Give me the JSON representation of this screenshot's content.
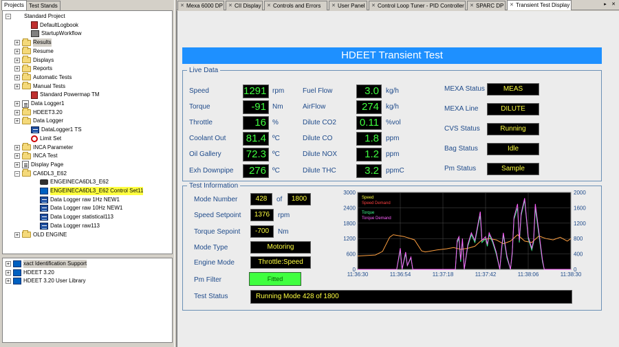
{
  "left_panel": {
    "tabs": [
      "Projects",
      "Test Stands"
    ],
    "tree": [
      {
        "label": "Standard Project",
        "icon": "project",
        "exp": "−",
        "level": 0
      },
      {
        "label": "DefaultLogbook",
        "icon": "book",
        "level": 2
      },
      {
        "label": "StartupWorkflow",
        "icon": "wf",
        "level": 2
      },
      {
        "label": "Results",
        "icon": "folder",
        "exp": "+",
        "level": 1
      },
      {
        "label": "Resume",
        "icon": "folder",
        "exp": "+",
        "level": 1
      },
      {
        "label": "Displays",
        "icon": "folder",
        "exp": "+",
        "level": 1
      },
      {
        "label": "Reports",
        "icon": "folder",
        "exp": "+",
        "level": 1
      },
      {
        "label": "Automatic Tests",
        "icon": "folder",
        "exp": "+",
        "level": 1
      },
      {
        "label": "Manual Tests",
        "icon": "folder",
        "exp": "+",
        "level": 1
      },
      {
        "label": "Standard Powermap TM",
        "icon": "book",
        "level": 2
      },
      {
        "label": "Data Logger1",
        "icon": "doc",
        "exp": "+",
        "level": 1
      },
      {
        "label": "HDEET3.20",
        "icon": "folder",
        "exp": "+",
        "level": 1
      },
      {
        "label": "Data Logger",
        "icon": "folder",
        "exp": "+",
        "level": 1
      },
      {
        "label": "DataLogger1 TS",
        "icon": "dl",
        "level": 2
      },
      {
        "label": "Limit Set",
        "icon": "limit",
        "level": 2
      },
      {
        "label": "INCA Parameter",
        "icon": "folder",
        "exp": "+",
        "level": 1
      },
      {
        "label": "INCA Test",
        "icon": "folder",
        "exp": "+",
        "level": 1
      },
      {
        "label": "Display Page",
        "icon": "doc",
        "exp": "+",
        "level": 1
      },
      {
        "label": "CA6DL3_E62",
        "icon": "folder",
        "exp": "−",
        "level": 1
      },
      {
        "label": "ENGEINECA6DL3_E62",
        "icon": "eng",
        "level": 3
      },
      {
        "label": "ENGEINECA6DL3_E62 Control Set11",
        "icon": "ctrl",
        "level": 3,
        "selected": true
      },
      {
        "label": "Data Logger raw  1Hz NEW1",
        "icon": "dl",
        "level": 3
      },
      {
        "label": "Data Logger raw 10Hz NEW1",
        "icon": "dl",
        "level": 3
      },
      {
        "label": "Data Logger statistical113",
        "icon": "dl",
        "level": 3
      },
      {
        "label": "Data Logger raw113",
        "icon": "dl",
        "level": 3
      },
      {
        "label": "OLD ENGINE",
        "icon": "folder",
        "exp": "+",
        "level": 1
      }
    ],
    "tree2": [
      {
        "label": "xact Identification Support",
        "icon": "ctrl",
        "exp": "+",
        "selected_gray": true
      },
      {
        "label": "HDEET 3.20",
        "icon": "ctrl",
        "exp": "+"
      },
      {
        "label": "HDEET 3.20 User Library",
        "icon": "ctrl",
        "exp": "+"
      }
    ]
  },
  "tabs": [
    {
      "label": "Mexa 6000 DP"
    },
    {
      "label": "CII Display"
    },
    {
      "label": "Controls and Errors"
    },
    {
      "label": "User Panel"
    },
    {
      "label": "Control Loop Tuner - PID Controller"
    },
    {
      "label": "SPARC DP"
    },
    {
      "label": "Transient Test Display",
      "active": true
    }
  ],
  "main": {
    "title": "HDEET Transient Test",
    "live_data": {
      "title": "Live Data",
      "col1": [
        {
          "label": "Speed",
          "value": "1291",
          "unit": "rpm"
        },
        {
          "label": "Torque",
          "value": "-91",
          "unit": "Nm"
        },
        {
          "label": "Throttle",
          "value": "16",
          "unit": "%"
        },
        {
          "label": "Coolant Out",
          "value": "81.4",
          "unit": "ºC"
        },
        {
          "label": "Oil Gallery",
          "value": "72.3",
          "unit": "ºC"
        },
        {
          "label": "Exh Downpipe",
          "value": "276",
          "unit": "ºC"
        }
      ],
      "col2": [
        {
          "label": "Fuel Flow",
          "value": "3.0",
          "unit": "kg/h"
        },
        {
          "label": "AirFlow",
          "value": "274",
          "unit": "kg/h"
        },
        {
          "label": "Dilute CO2",
          "value": "0.11",
          "unit": "%vol"
        },
        {
          "label": "Dilute CO",
          "value": "1.8",
          "unit": "ppm"
        },
        {
          "label": "Dilute NOX",
          "value": "1.2",
          "unit": "ppm"
        },
        {
          "label": "Dilute THC",
          "value": "3.2",
          "unit": "ppmC"
        }
      ],
      "col3": [
        {
          "label": "MEXA Status",
          "value": "MEAS"
        },
        {
          "label": "MEXA Line",
          "value": "DILUTE"
        },
        {
          "label": "CVS Status",
          "value": "Running"
        },
        {
          "label": "Bag Status",
          "value": "Idle"
        },
        {
          "label": "Pm Status",
          "value": "Sample"
        }
      ]
    },
    "test_info": {
      "title": "Test Information",
      "mode_number_label": "Mode Number",
      "mode_number": "428",
      "of_label": "of",
      "mode_total": "1800",
      "speed_setpoint_label": "Speed Setpoint",
      "speed_setpoint": "1376",
      "speed_unit": "rpm",
      "torque_setpoint_label": "Torque Sepoint",
      "torque_setpoint": "-700",
      "torque_unit": "Nm",
      "mode_type_label": "Mode Type",
      "mode_type": "Motoring",
      "engine_mode_label": "Engine Mode",
      "engine_mode": "Throttle:Speed",
      "pm_filter_label": "Pm Filter",
      "pm_filter": "Fitted",
      "test_status_label": "Test Status",
      "test_status": "Running Mode 428 of 1800"
    }
  },
  "chart_data": {
    "type": "line",
    "x_ticks": [
      "11:36:30",
      "11:36:54",
      "11:37:18",
      "11:37:42",
      "11:38:06",
      "11:38:30"
    ],
    "y_left_ticks": [
      "3000",
      "2400",
      "1800",
      "1200",
      "600",
      "0"
    ],
    "y_right_ticks": [
      "2000",
      "1600",
      "1200",
      "800",
      "400",
      "0"
    ],
    "ylim_left": [
      0,
      3000
    ],
    "ylim_right": [
      0,
      2000
    ],
    "xlim": [
      0,
      120
    ],
    "legend": [
      "Speed",
      "Speed Demand",
      "Torque",
      "Torque Demand"
    ],
    "colors": {
      "Speed": "#ffff40",
      "Speed Demand": "#ff4040",
      "Torque": "#40ff90",
      "Torque Demand": "#ff60ff",
      "speed_line": "#ffa040"
    },
    "series": [
      {
        "name": "Speed",
        "axis": "left",
        "color": "#ffa040",
        "x": [
          0,
          10,
          14,
          18,
          20,
          26,
          32,
          36,
          38,
          40,
          45,
          50,
          54,
          58,
          62,
          66,
          70,
          74,
          78,
          82,
          86,
          90,
          94,
          98,
          102,
          106,
          110,
          114,
          118,
          120
        ],
        "y": [
          520,
          560,
          700,
          1250,
          1350,
          1280,
          1150,
          720,
          680,
          700,
          760,
          800,
          850,
          780,
          820,
          900,
          1150,
          1200,
          1150,
          1000,
          1100,
          1350,
          1100,
          1050,
          1300,
          1200,
          1150,
          1250,
          1100,
          1200
        ]
      },
      {
        "name": "Torque",
        "axis": "right",
        "color": "#40ff90",
        "x": [
          0,
          22,
          24,
          25,
          27,
          28,
          30,
          31,
          50,
          55,
          56,
          57,
          58,
          59,
          60,
          62,
          64,
          66,
          68,
          69,
          70,
          72,
          73,
          74,
          76,
          78,
          80,
          81,
          82,
          83,
          84,
          86,
          87,
          88,
          90,
          91,
          92,
          94,
          96,
          98,
          99,
          100,
          104,
          105,
          106,
          110,
          120
        ],
        "y": [
          0,
          0,
          500,
          0,
          400,
          100,
          300,
          0,
          0,
          0,
          700,
          800,
          200,
          750,
          0,
          600,
          900,
          700,
          1200,
          1400,
          700,
          800,
          600,
          900,
          700,
          400,
          0,
          500,
          900,
          600,
          300,
          0,
          400,
          1300,
          1600,
          700,
          1400,
          1800,
          800,
          500,
          700,
          1600,
          200,
          0,
          0,
          0,
          0
        ]
      },
      {
        "name": "Torque Demand",
        "axis": "right",
        "color": "#ff60ff",
        "x": [
          0,
          22,
          24,
          25,
          27,
          28,
          30,
          31,
          50,
          55,
          56,
          57,
          58,
          59,
          60,
          62,
          64,
          66,
          68,
          69,
          70,
          72,
          73,
          74,
          76,
          78,
          80,
          81,
          82,
          83,
          84,
          86,
          87,
          88,
          90,
          91,
          92,
          94,
          96,
          98,
          99,
          100,
          104,
          105,
          106,
          110,
          120
        ],
        "y": [
          0,
          0,
          550,
          0,
          450,
          100,
          320,
          0,
          0,
          0,
          750,
          850,
          250,
          800,
          0,
          650,
          950,
          750,
          1250,
          1500,
          750,
          850,
          650,
          950,
          750,
          450,
          0,
          550,
          950,
          650,
          350,
          0,
          450,
          1350,
          1700,
          750,
          1450,
          1850,
          850,
          550,
          750,
          1700,
          250,
          0,
          0,
          0,
          0
        ]
      }
    ]
  }
}
